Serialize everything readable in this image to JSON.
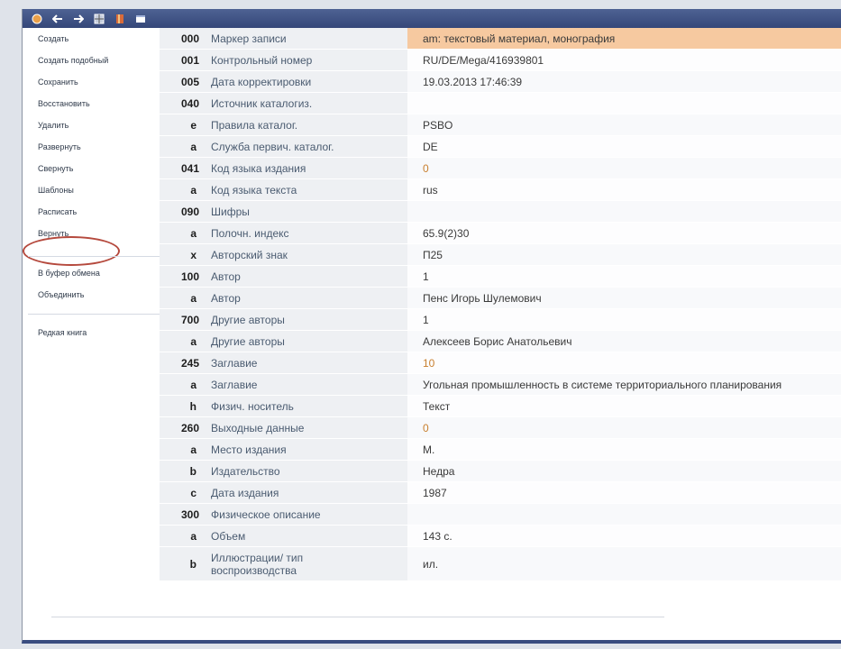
{
  "sidebar": {
    "items": [
      {
        "label": "Создать"
      },
      {
        "label": "Создать подобный"
      },
      {
        "label": "Сохранить"
      },
      {
        "label": "Восстановить"
      },
      {
        "label": "Удалить"
      },
      {
        "label": "Развернуть"
      },
      {
        "label": "Свернуть"
      },
      {
        "label": "Шаблоны"
      },
      {
        "label": "Расписать"
      },
      {
        "label": "Вернуть"
      },
      {
        "label": "В буфер обмена"
      },
      {
        "label": "Объединить"
      },
      {
        "label": "Редкая книга"
      }
    ]
  },
  "colors": {
    "toolbar": "#3e5186",
    "highlight": "#f6c9a0",
    "annotation_oval": "#b5493d"
  },
  "record": {
    "rows": [
      {
        "code": "000",
        "sub": "",
        "name": "Маркер записи",
        "value": "am: текстовый материал, монография",
        "highlight": true
      },
      {
        "code": "001",
        "sub": "",
        "name": "Контрольный номер",
        "value": "RU/DE/Mega/416939801"
      },
      {
        "code": "005",
        "sub": "",
        "name": "Дата корректировки",
        "value": "19.03.2013 17:46:39"
      },
      {
        "code": "040",
        "sub": "",
        "name": "Источник каталогиз.",
        "value": ""
      },
      {
        "code": "",
        "sub": "e",
        "name": "Правила каталог.",
        "value": "PSBO"
      },
      {
        "code": "",
        "sub": "a",
        "name": "Служба первич. каталог.",
        "value": "DE"
      },
      {
        "code": "041",
        "sub": "",
        "name": "Код языка издания",
        "value": "0",
        "orange": true
      },
      {
        "code": "",
        "sub": "a",
        "name": "Код языка текста",
        "value": "rus"
      },
      {
        "code": "090",
        "sub": "",
        "name": "Шифры",
        "value": ""
      },
      {
        "code": "",
        "sub": "a",
        "name": "Полочн. индекс",
        "value": "65.9(2)30"
      },
      {
        "code": "",
        "sub": "x",
        "name": "Авторский знак",
        "value": "П25"
      },
      {
        "code": "100",
        "sub": "",
        "name": "Автор",
        "value": "1"
      },
      {
        "code": "",
        "sub": "a",
        "name": "Автор",
        "value": "Пенс Игорь Шулемович"
      },
      {
        "code": "700",
        "sub": "",
        "name": "Другие авторы",
        "value": "1"
      },
      {
        "code": "",
        "sub": "a",
        "name": "Другие авторы",
        "value": "Алексеев Борис Анатольевич"
      },
      {
        "code": "245",
        "sub": "",
        "name": "Заглавие",
        "value": "10",
        "orange": true
      },
      {
        "code": "",
        "sub": "a",
        "name": "Заглавие",
        "value": "Угольная промышленность в системе территориального планирования"
      },
      {
        "code": "",
        "sub": "h",
        "name": "Физич. носитель",
        "value": "Текст"
      },
      {
        "code": "260",
        "sub": "",
        "name": "Выходные данные",
        "value": "0",
        "orange": true
      },
      {
        "code": "",
        "sub": "a",
        "name": "Место издания",
        "value": "М."
      },
      {
        "code": "",
        "sub": "b",
        "name": "Издательство",
        "value": "Недра"
      },
      {
        "code": "",
        "sub": "c",
        "name": "Дата издания",
        "value": "1987"
      },
      {
        "code": "300",
        "sub": "",
        "name": "Физическое описание",
        "value": ""
      },
      {
        "code": "",
        "sub": "a",
        "name": "Объем",
        "value": "143 с."
      },
      {
        "code": "",
        "sub": "b",
        "name": "Иллюстрации/ тип воспроизводства",
        "value": "ил."
      }
    ]
  }
}
